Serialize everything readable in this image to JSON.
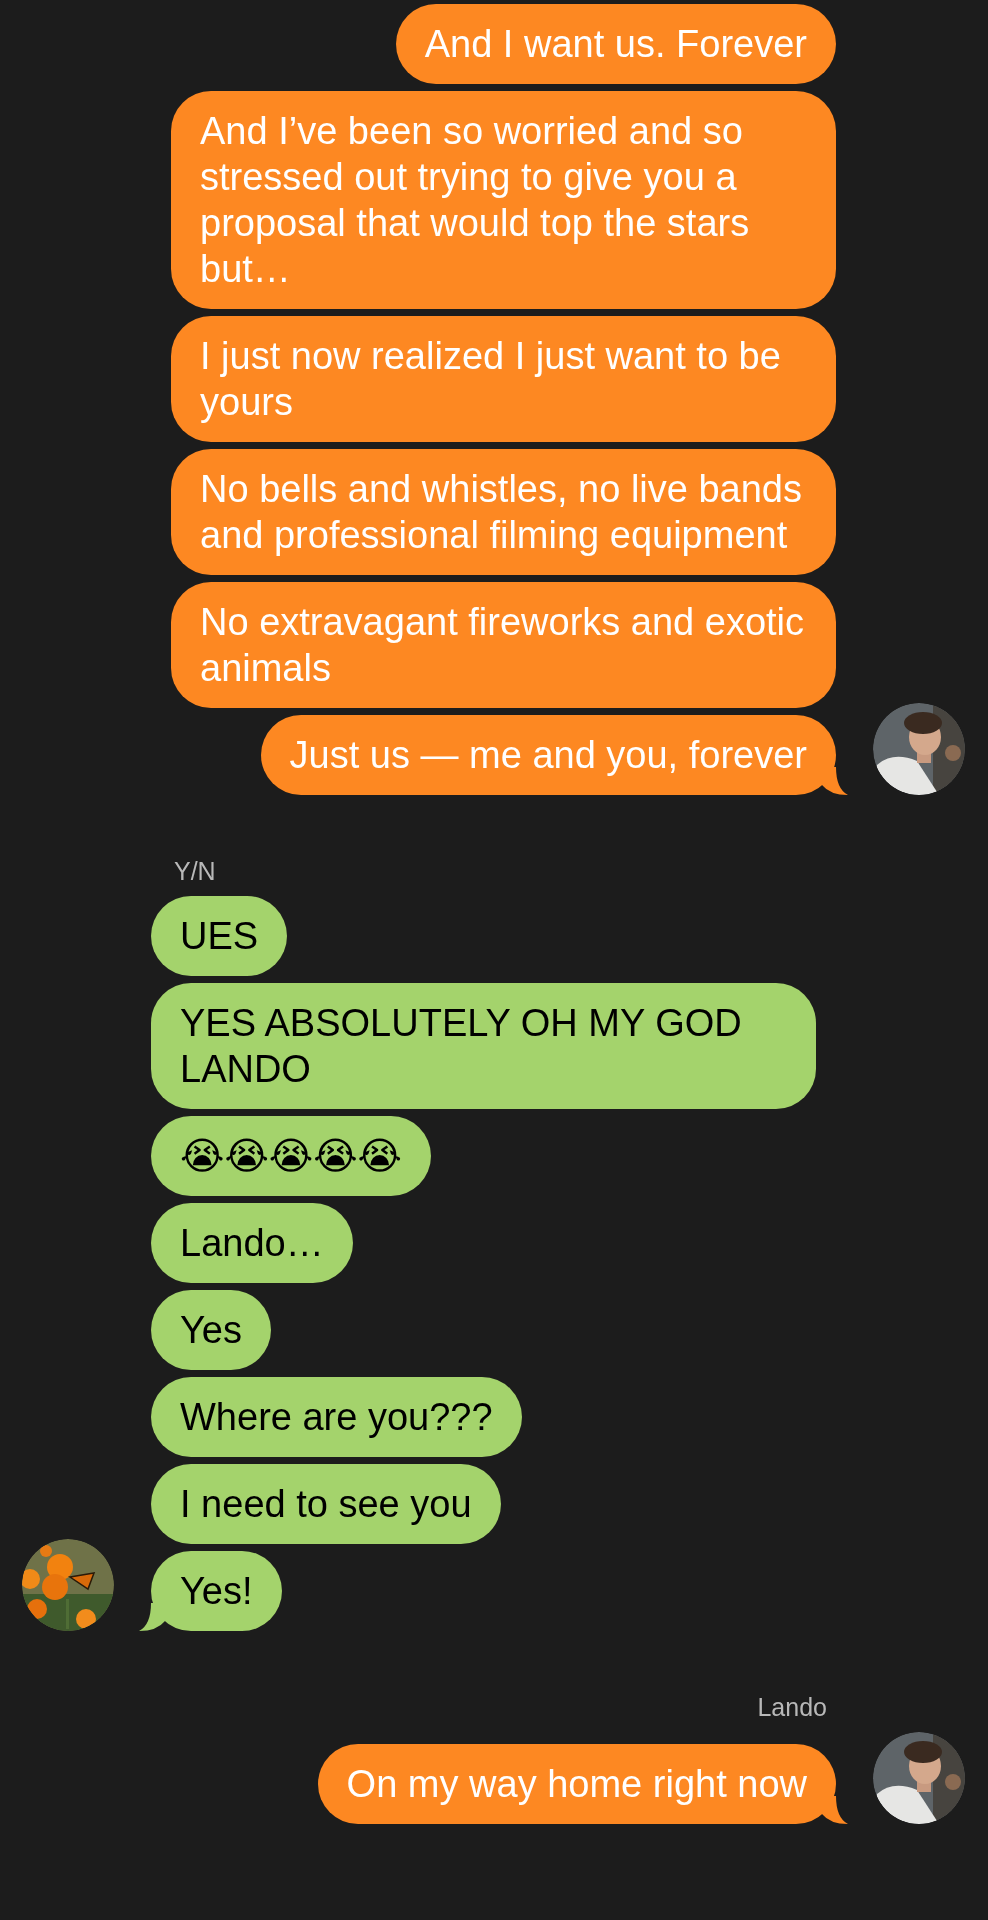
{
  "groups": [
    {
      "kind": "outgoing",
      "messages": [
        "And I want us. Forever",
        "And I’ve been so worried and so stressed out trying to give you a proposal that would top the stars but…",
        "I just now realized I just want to be yours",
        "No bells and whistles, no live bands and professional filming equipment",
        "No extravagant fireworks and exotic animals",
        "Just us — me and you, forever"
      ]
    },
    {
      "kind": "incoming",
      "sender": "Y/N",
      "messages": [
        "UES",
        "YES ABSOLUTELY OH MY GOD LANDO",
        "😭😭😭😭😭",
        "Lando…",
        "Yes",
        "Where are you???",
        "I need to see you",
        "Yes!"
      ]
    },
    {
      "kind": "outgoing",
      "sender": "Lando",
      "messages": [
        "On my way home right now"
      ]
    }
  ]
}
